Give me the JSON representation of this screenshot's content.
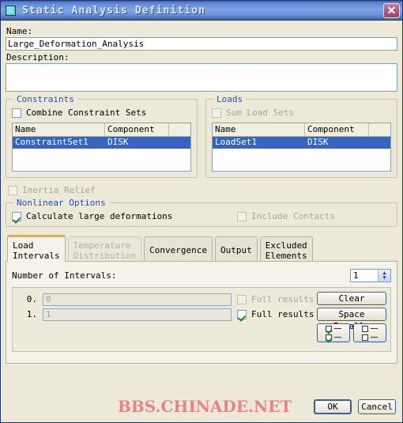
{
  "window": {
    "title": "Static Analysis Definition",
    "icon": "app-square-icon",
    "close_label": "✕"
  },
  "form": {
    "name_label": "Name:",
    "name_value": "Large_Deformation_Analysis",
    "description_label": "Description:",
    "description_value": ""
  },
  "constraints": {
    "title": "Constraints",
    "combine_label": "Combine Constraint Sets",
    "combine_checked": false,
    "columns": [
      "Name",
      "Component",
      ""
    ],
    "rows": [
      {
        "name": "ConstraintSet1",
        "component": "DISK",
        "extra": "",
        "selected": true
      }
    ]
  },
  "loads": {
    "title": "Loads",
    "sum_label": "Sum Load Sets",
    "sum_checked": false,
    "sum_disabled": true,
    "columns": [
      "Name",
      "Component",
      ""
    ],
    "rows": [
      {
        "name": "LoadSet1",
        "component": "DISK",
        "extra": "",
        "selected": true
      }
    ]
  },
  "inertia": {
    "label": "Inertia Relief",
    "checked": false,
    "disabled": true
  },
  "nonlinear": {
    "title": "Nonlinear Options",
    "large_deformations_label": "Calculate large deformations",
    "large_deformations_checked": true,
    "include_contacts_label": "Include Contacts",
    "include_contacts_checked": false,
    "include_contacts_disabled": true
  },
  "tabs": [
    {
      "id": "load-intervals",
      "line1": "Load",
      "line2": "Intervals",
      "active": true,
      "disabled": false
    },
    {
      "id": "temperature-distribution",
      "line1": "Temperature",
      "line2": "Distribution",
      "active": false,
      "disabled": true
    },
    {
      "id": "convergence",
      "line1": "Convergence",
      "line2": "",
      "active": false,
      "disabled": false
    },
    {
      "id": "output",
      "line1": "Output",
      "line2": "",
      "active": false,
      "disabled": false
    },
    {
      "id": "excluded-elements",
      "line1": "Excluded",
      "line2": "Elements",
      "active": false,
      "disabled": false
    }
  ],
  "intervals": {
    "count_label": "Number of Intervals:",
    "count_value": "1",
    "spin_up": "▲",
    "spin_down": "▼",
    "rows": [
      {
        "index": "0.",
        "value": "0",
        "full_results_label": "Full results",
        "full_results_checked": false,
        "disabled": true
      },
      {
        "index": "1.",
        "value": "1",
        "full_results_label": "Full results",
        "full_results_checked": true,
        "disabled": false
      }
    ],
    "clear_label": "Clear",
    "space_equally_label": "Space Equally",
    "check_all_icon": "check-all-icon",
    "uncheck_all_icon": "uncheck-all-icon"
  },
  "footer": {
    "watermark": "BBS.CHINADE.NET",
    "ok_label": "OK",
    "cancel_label": "Cancel"
  },
  "colors": {
    "titlebar_blue": "#5f86d8",
    "dialog_bg": "#ece9d8",
    "selection_blue": "#3465c4",
    "group_title_blue": "#2a4fb0",
    "active_tab_accent": "#f0a830",
    "watermark_red": "#f08080",
    "check_green": "#1a8a2e"
  }
}
